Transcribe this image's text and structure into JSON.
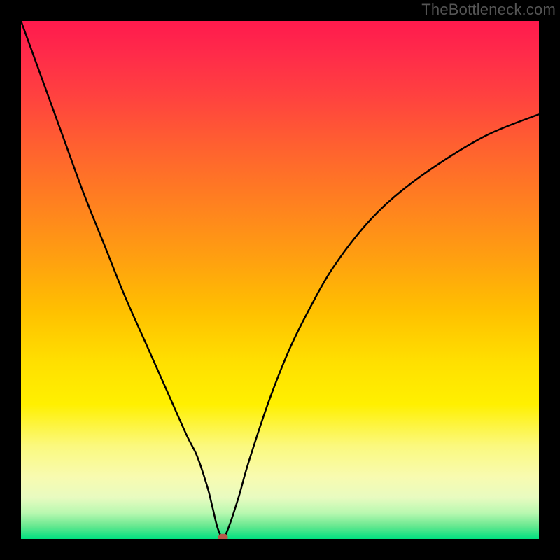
{
  "attribution": "TheBottleneck.com",
  "chart_data": {
    "type": "line",
    "title": "",
    "xlabel": "",
    "ylabel": "",
    "xlim": [
      0,
      100
    ],
    "ylim": [
      0,
      100
    ],
    "grid": false,
    "legend": null,
    "annotation_note": "V-shaped bottleneck curve over a vertical red-to-green gradient background; minimum marked by a small dark-red pill near the x-axis.",
    "series": [
      {
        "name": "bottleneck-curve",
        "x": [
          0,
          4,
          8,
          12,
          16,
          20,
          24,
          28,
          32,
          34,
          36,
          37,
          38,
          39,
          40,
          42,
          44,
          48,
          52,
          56,
          60,
          66,
          72,
          80,
          90,
          100
        ],
        "values": [
          100,
          89,
          78,
          67,
          57,
          47,
          38,
          29,
          20,
          16,
          10,
          6,
          2,
          0.3,
          2,
          8,
          15,
          27,
          37,
          45,
          52,
          60,
          66,
          72,
          78,
          82
        ]
      }
    ],
    "marker": {
      "x": 39,
      "y": 0.3
    },
    "colors": {
      "curve": "#000000",
      "marker": "#b85a4a",
      "gradient_top": "#ff1a4d",
      "gradient_bottom": "#00e080"
    }
  }
}
